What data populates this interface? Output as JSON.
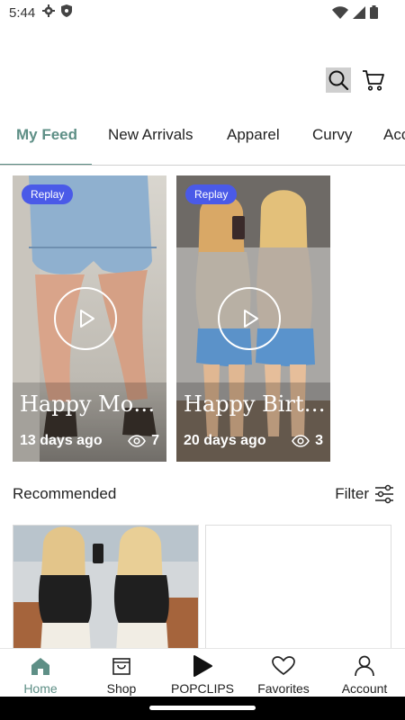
{
  "status_bar": {
    "time": "5:44"
  },
  "tabs": [
    {
      "label": "My Feed",
      "active": true
    },
    {
      "label": "New Arrivals",
      "active": false
    },
    {
      "label": "Apparel",
      "active": false
    },
    {
      "label": "Curvy",
      "active": false
    },
    {
      "label": "Acc",
      "active": false
    }
  ],
  "clips": [
    {
      "badge": "Replay",
      "title": "Happy Mond...",
      "age": "13 days ago",
      "views": "7"
    },
    {
      "badge": "Replay",
      "title": "Happy Birthd...",
      "age": "20 days ago",
      "views": "3"
    }
  ],
  "recommended": {
    "title": "Recommended",
    "filter_label": "Filter"
  },
  "bottom_nav": [
    {
      "label": "Home",
      "icon": "home-icon",
      "active": true
    },
    {
      "label": "Shop",
      "icon": "shopping-bag-icon",
      "active": false
    },
    {
      "label": "POPCLIPS",
      "icon": "play-icon",
      "active": false
    },
    {
      "label": "Favorites",
      "icon": "heart-icon",
      "active": false
    },
    {
      "label": "Account",
      "icon": "person-icon",
      "active": false
    }
  ],
  "colors": {
    "accent": "#5e8f86",
    "badge": "#4a5ae8"
  }
}
